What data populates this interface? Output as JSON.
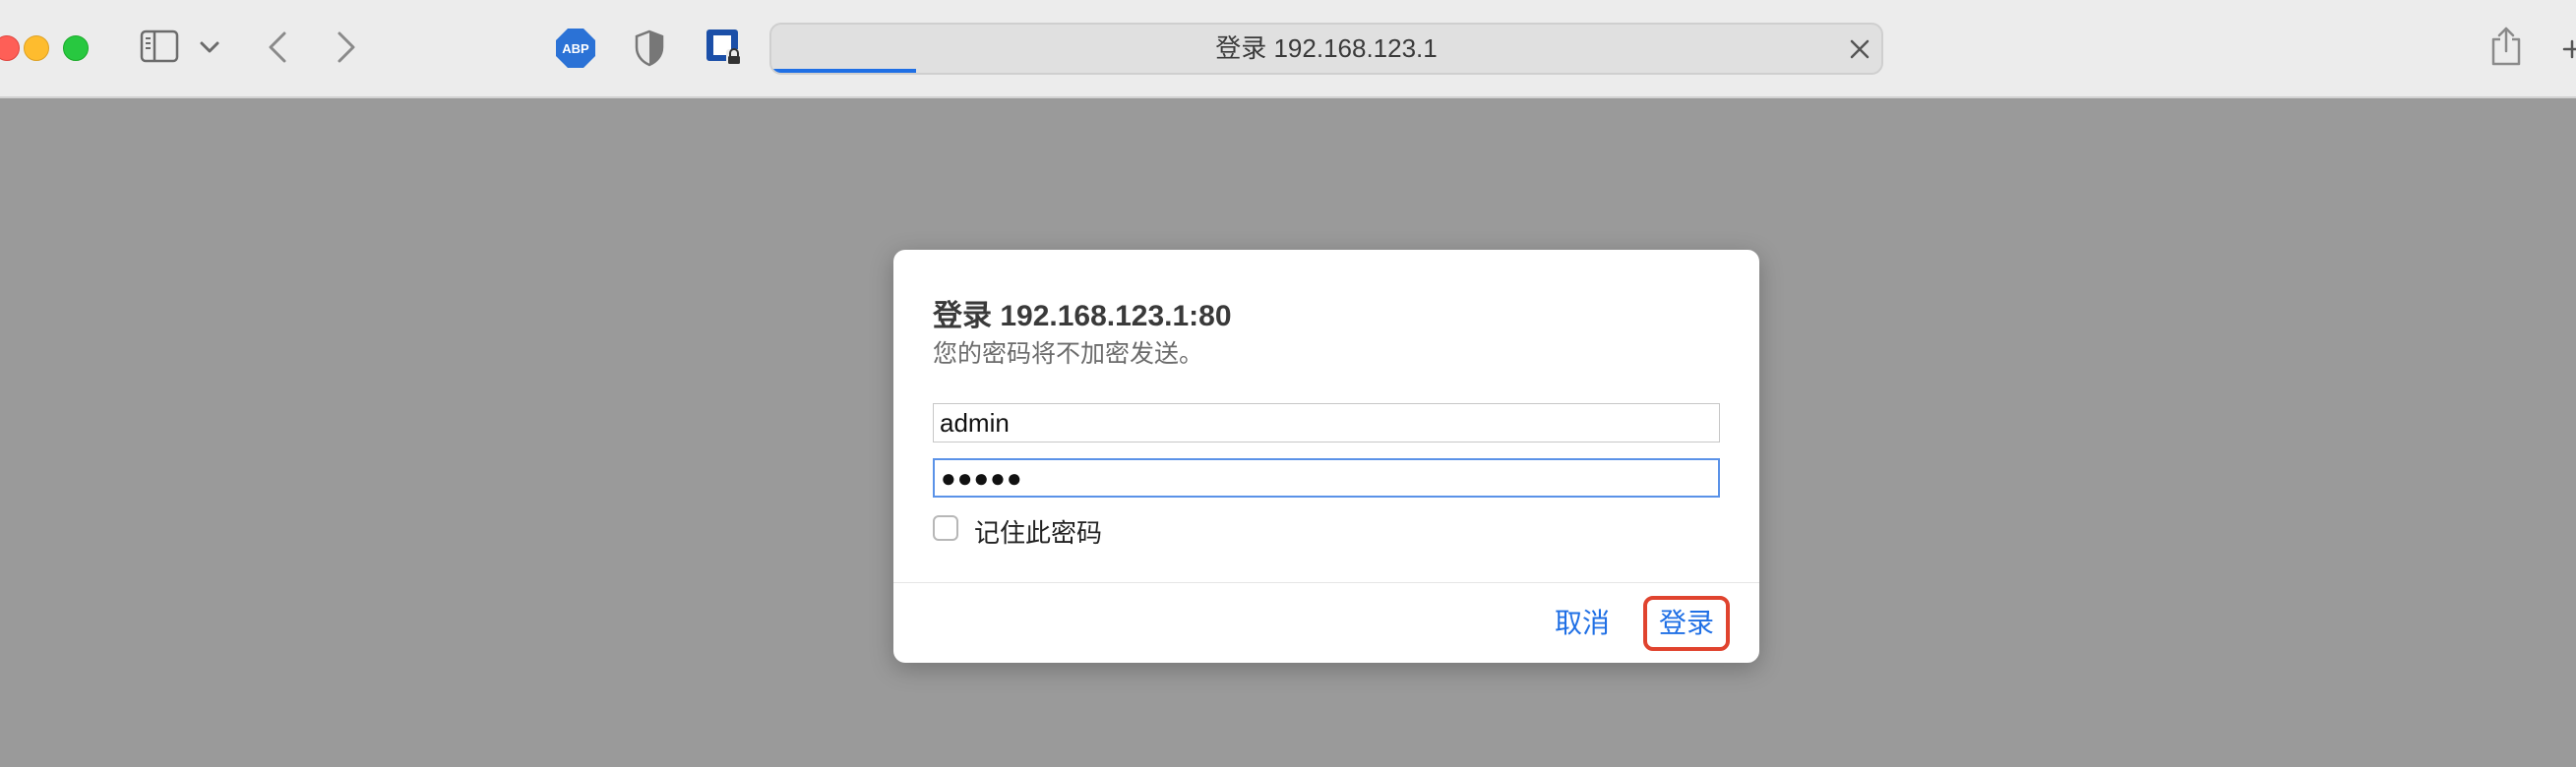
{
  "toolbar": {
    "address": "登录 192.168.123.1",
    "load_progress_percent": 13,
    "extensions": {
      "abp_label": "ABP"
    }
  },
  "dialog": {
    "title": "登录 192.168.123.1:80",
    "subtitle": "您的密码将不加密发送。",
    "username_value": "admin",
    "password_value": "●●●●●",
    "remember_label": "记住此密码",
    "remember_checked": false,
    "cancel_label": "取消",
    "login_label": "登录"
  },
  "colors": {
    "accent": "#1f6fe5",
    "highlight_border": "#e0432e",
    "page_background": "#9a9a9a"
  },
  "icons": {
    "window": [
      "close-window-icon",
      "minimize-window-icon",
      "zoom-window-icon"
    ],
    "toolbar": [
      "sidebar-icon",
      "chevron-down-icon",
      "back-arrow-icon",
      "forward-arrow-icon",
      "adblock-plus-icon",
      "privacy-shield-icon",
      "password-manager-icon",
      "stop-loading-icon",
      "share-icon",
      "new-tab-icon"
    ]
  }
}
